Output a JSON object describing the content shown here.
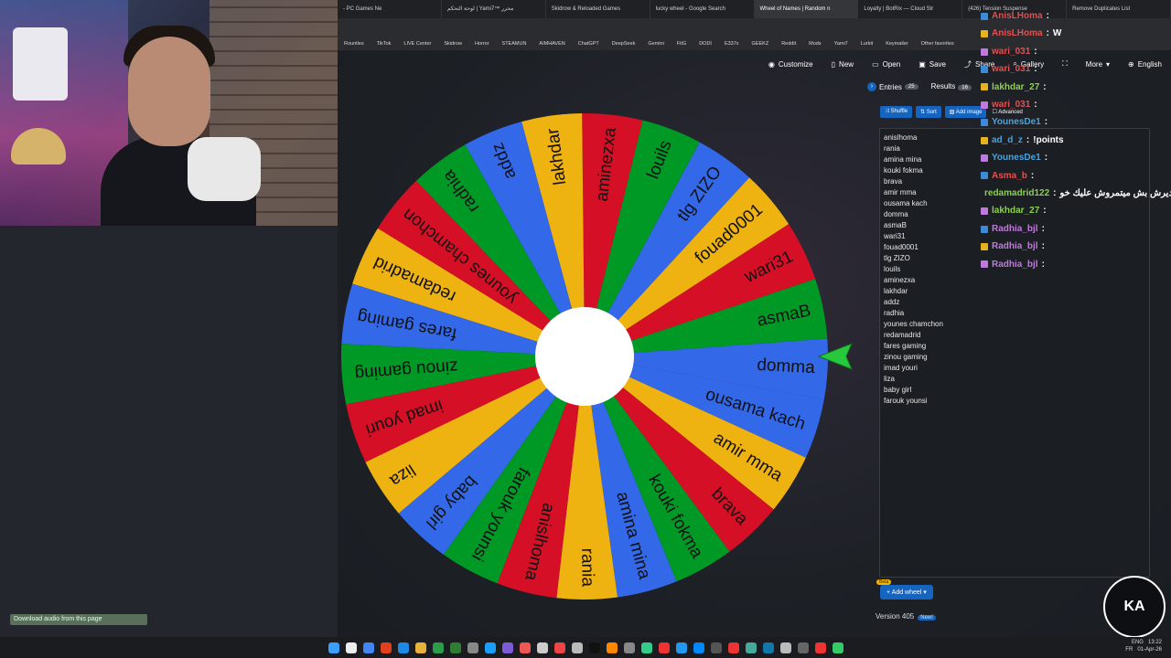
{
  "browser": {
    "tabs": [
      {
        "label": "- PC Games Ne",
        "active": false
      },
      {
        "label": "لوحة التحكم | Yami7™ محرر",
        "active": false
      },
      {
        "label": "Skidrow & Reloaded Games",
        "active": false
      },
      {
        "label": "lucky wheel - Google Search",
        "active": false
      },
      {
        "label": "Wheel of Names | Random n",
        "active": true
      },
      {
        "label": "Loyalty | BotRix — Cloud Str",
        "active": false
      },
      {
        "label": "(426) Tension Suspense",
        "active": false
      },
      {
        "label": "Remove Duplicates List",
        "active": false
      }
    ],
    "bookmarks": [
      "Rountles",
      "TikTok",
      "LIVE Center",
      "Skidrow",
      "Horror",
      "STEAMUN",
      "AIMHAVEN",
      "ChatGPT",
      "DeepSeek",
      "Gemini",
      "FitG",
      "DODI",
      "E337x",
      "GEEKZ",
      "Reddit",
      "Mods",
      "Yami7",
      "Lurkit",
      "Keymailer",
      "Other favorites"
    ]
  },
  "nav": {
    "customize": "Customize",
    "new": "New",
    "open": "Open",
    "save": "Save",
    "share": "Share",
    "gallery": "Gallery",
    "more": "More",
    "language": "English"
  },
  "panel": {
    "entries_tab": "Entries",
    "entries_count": "25",
    "results_tab": "Results",
    "results_count": "16",
    "shuffle": "Shuffle",
    "sort": "Sort",
    "add_image": "Add image",
    "advanced": "Advanced",
    "add_wheel": "Add wheel",
    "beta": "Beta",
    "version": "Version 405",
    "new_badge": "New!"
  },
  "entries": [
    "anislhoma",
    "rania",
    "amina mina",
    "kouki fokma",
    "brava",
    "amir mma",
    "ousama kach",
    "domma",
    "asmaB",
    "wari31",
    "fouad0001",
    "tlg ZIZO",
    "louils",
    "aminezxa",
    "lakhdar",
    "addz",
    "radhia",
    "younes chamchon",
    "redamadrid",
    "fares gaming",
    "zinou gaming",
    "imad youri",
    "liza",
    "baby girl",
    "farouk younsi"
  ],
  "wheel": {
    "segments": [
      "domma",
      "asmaB",
      "wari31",
      "fouad0001",
      "tlg ZIZO",
      "louils",
      "aminezxa",
      "lakhdar",
      "addz",
      "radhia",
      "younes chamchon",
      "redamadrid",
      "fares gaming",
      "zinou gaming",
      "imad youri",
      "liza",
      "baby girl",
      "farouk younsi",
      "anislhoma",
      "rania",
      "amina mina",
      "kouki fokma",
      "brava",
      "amir mma",
      "ousama kach"
    ],
    "colors": [
      "#3369e8",
      "#009925",
      "#d50f25",
      "#eeb211"
    ]
  },
  "chat": [
    {
      "user": "AnisLHoma",
      "msg": "",
      "color": "#e05252"
    },
    {
      "user": "AnisLHoma",
      "msg": "W",
      "color": "#e05252"
    },
    {
      "user": "wari_031",
      "msg": "",
      "color": "#e05252"
    },
    {
      "user": "wari_031",
      "msg": "",
      "color": "#e05252"
    },
    {
      "user": "lakhdar_27",
      "msg": "",
      "color": "#8ad24a"
    },
    {
      "user": "wari_031",
      "msg": "",
      "color": "#e05252"
    },
    {
      "user": "YounesDe1",
      "msg": "",
      "color": "#4aa3df"
    },
    {
      "user": "ad_d_z",
      "msg": "!points",
      "color": "#4aa3df"
    },
    {
      "user": "YounesDe1",
      "msg": "",
      "color": "#4aa3df"
    },
    {
      "user": "Asma_b",
      "msg": "",
      "color": "#e05252"
    },
    {
      "user": "redamadrid122",
      "msg": "مديرش بش ميتمروش عليك خو",
      "color": "#8ad24a"
    },
    {
      "user": "lakhdar_27",
      "msg": "",
      "color": "#8ad24a"
    },
    {
      "user": "Radhia_bjl",
      "msg": "",
      "color": "#c07adf"
    },
    {
      "user": "Radhia_bjl",
      "msg": "",
      "color": "#c07adf"
    },
    {
      "user": "Radhia_bjl",
      "msg": "",
      "color": "#c07adf"
    }
  ],
  "stream": {
    "download_audio": "Download audio from this page"
  },
  "system": {
    "lang1": "ENG",
    "lang2": "FR",
    "time": "13:22",
    "date": "01-Apr-26"
  },
  "logo_text": "KA"
}
